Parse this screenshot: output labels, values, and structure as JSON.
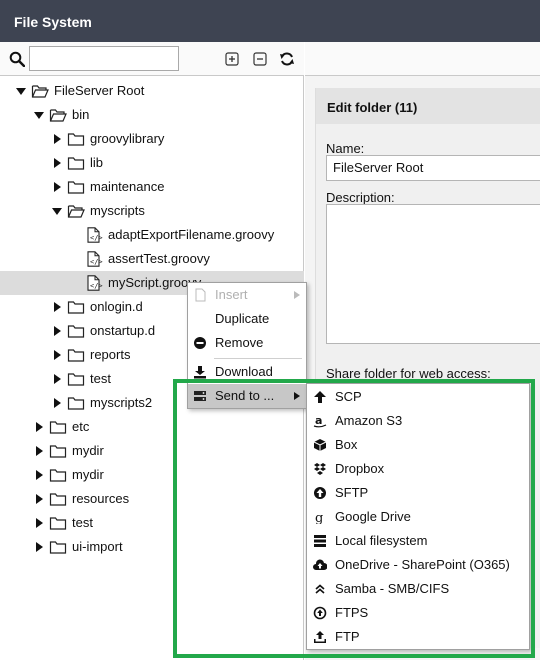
{
  "window": {
    "title": "File System"
  },
  "search": {
    "value": "",
    "placeholder": ""
  },
  "toolbar": {
    "icons": [
      "search-icon",
      "expand-all-icon",
      "collapse-all-icon",
      "refresh-icon"
    ]
  },
  "tree": {
    "root": "FileServer Root",
    "bin": "bin",
    "groovylibrary": "groovylibrary",
    "lib": "lib",
    "maintenance": "maintenance",
    "myscripts": "myscripts",
    "file1": "adaptExportFilename.groovy",
    "file2": "assertTest.groovy",
    "file3": "myScript.groovy",
    "onlogin": "onlogin.d",
    "onstartup": "onstartup.d",
    "reports": "reports",
    "test_sub": "test",
    "myscripts2": "myscripts2",
    "etc": "etc",
    "mydir1": "mydir",
    "mydir2": "mydir",
    "resources": "resources",
    "test": "test",
    "uiimport": "ui-import"
  },
  "context_menu": {
    "insert": "Insert",
    "duplicate": "Duplicate",
    "remove": "Remove",
    "download": "Download",
    "send_to": "Send to ..."
  },
  "send_to_menu": {
    "scp": "SCP",
    "s3": "Amazon S3",
    "box": "Box",
    "dropbox": "Dropbox",
    "sftp": "SFTP",
    "gdrive": "Google Drive",
    "local": "Local filesystem",
    "onedrive": "OneDrive - SharePoint (O365)",
    "samba": "Samba - SMB/CIFS",
    "ftps": "FTPS",
    "ftp": "FTP"
  },
  "edit_panel": {
    "title": "Edit folder (11)",
    "name_label": "Name:",
    "name_value": "FileServer Root",
    "description_label": "Description:",
    "share_label": "Share folder for web access:"
  },
  "colors": {
    "titlebar": "#3e4452",
    "highlight_box": "#22a84a",
    "selected_row": "#dcdcdc"
  }
}
